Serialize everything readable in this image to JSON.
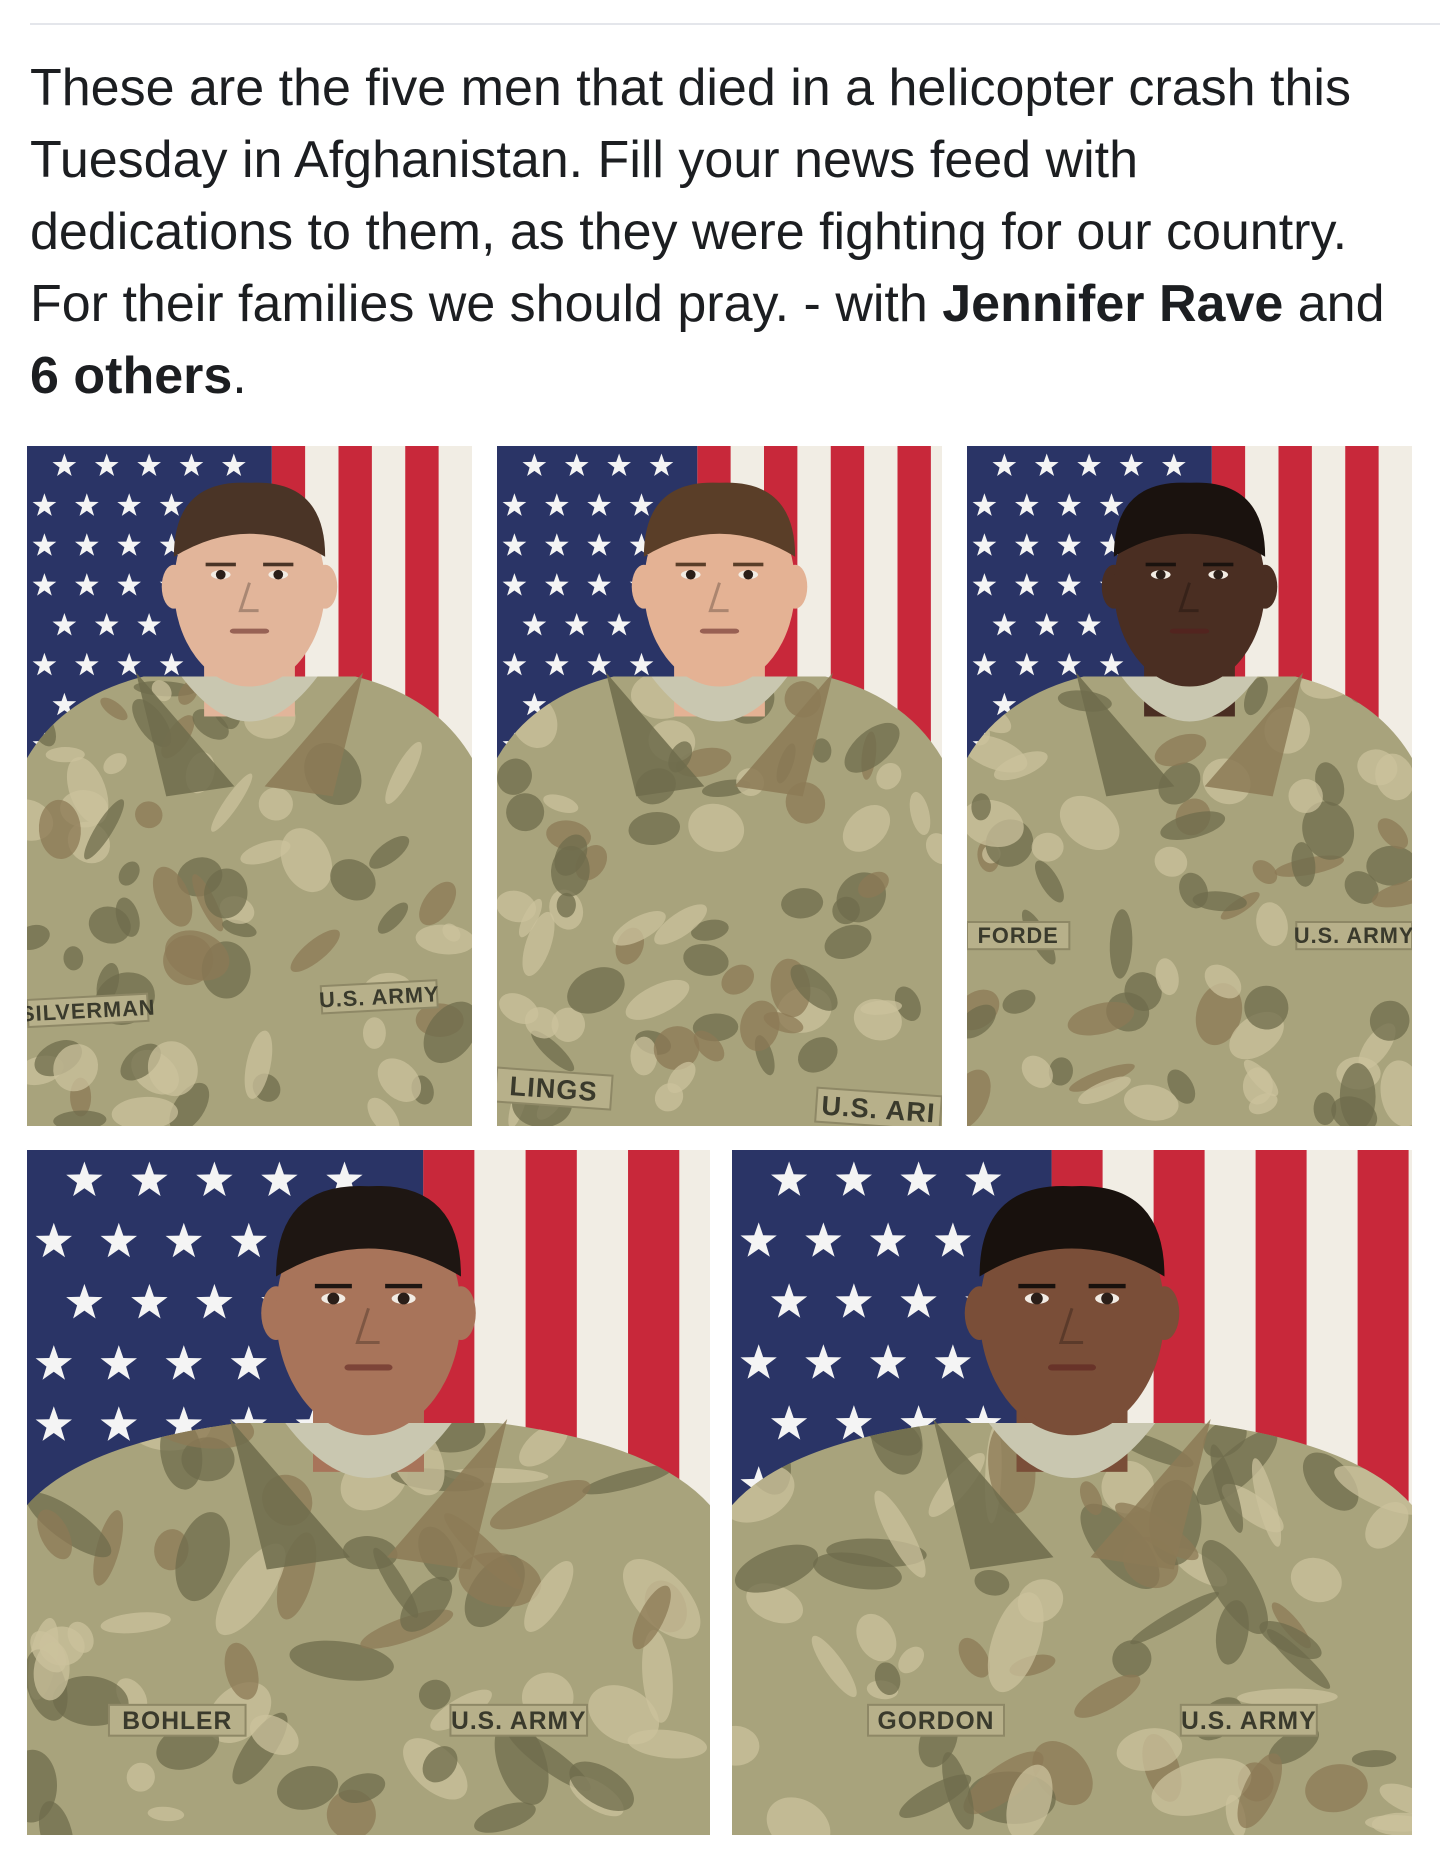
{
  "post": {
    "text_prefix": "These are the five men that died in a helicopter crash this Tuesday in Afghanistan. Fill your news feed with dedications to them, as they were fighting for our country.   For their families we should pray. - with ",
    "tag_primary": "Jennifer Rave",
    "connector": " and ",
    "tag_others": "6 others",
    "suffix": "."
  },
  "photos": [
    {
      "name_tape": "SILVERMAN",
      "branch_tape": "U.S. ARMY",
      "colors": {
        "skin": "#e2b59a",
        "hair": "#4a3426"
      }
    },
    {
      "name_tape": "LINGS",
      "branch_tape": "U.S. ARI",
      "colors": {
        "skin": "#e4b294",
        "hair": "#5a3e28"
      }
    },
    {
      "name_tape": "FORDE",
      "branch_tape": "U.S. ARMY",
      "colors": {
        "skin": "#4a2e22",
        "hair": "#1a120e"
      }
    },
    {
      "name_tape": "BOHLER",
      "branch_tape": "U.S. ARMY",
      "colors": {
        "skin": "#a8745a",
        "hair": "#1e1612"
      }
    },
    {
      "name_tape": "GORDON",
      "branch_tape": "U.S. ARMY",
      "colors": {
        "skin": "#7a4e38",
        "hair": "#18110d"
      }
    }
  ],
  "theme": {
    "flag_red": "#c8283a",
    "flag_white": "#f1ede4",
    "flag_blue": "#2a3466",
    "camo_base": "#a8a37c",
    "camo_dark": "#6f6c4c",
    "camo_light": "#cbc29c",
    "camo_brown": "#8c7a56",
    "tape": "#b7b08a"
  }
}
